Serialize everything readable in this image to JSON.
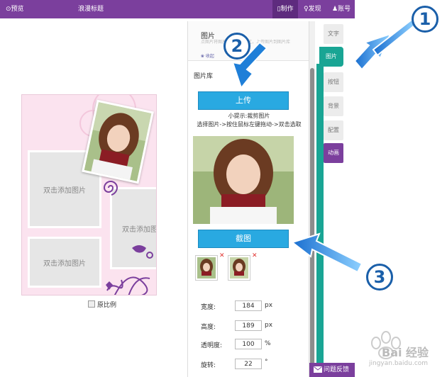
{
  "topbar": {
    "preview": "⊙预览",
    "title": "浪漫标题",
    "make": "▯制作",
    "discover": "♀发现",
    "account": "♟账号"
  },
  "canvas": {
    "slot_label_1": "双击添加图片",
    "slot_label_2": "双击添加图",
    "slot_label_3": "双击添加图片"
  },
  "panel": {
    "head_title": "图片",
    "head_desc": "点图片将图片添加至编辑区，上传图片到图片库",
    "head_link": "❀ 收起",
    "library_label": "图片库",
    "upload_button": "上传",
    "tip_1": "小提示:裁剪图片",
    "tip_2": "选择图片->按住鼠标左键拖动->双击选取",
    "crop_button": "截图",
    "width_label": "宽度:",
    "width_value": "184",
    "width_unit": "px",
    "height_label": "高度:",
    "height_value": "189",
    "height_unit": "px",
    "keep_ratio_label": "原比例",
    "opacity_label": "透明度:",
    "opacity_value": "100",
    "opacity_unit": "%",
    "rotate_label": "旋转:",
    "rotate_value": "22",
    "rotate_unit": "°"
  },
  "side_tabs": {
    "text": "文字",
    "image": "图片",
    "button": "按钮",
    "background": "背景",
    "music": "配置",
    "animation": "动画"
  },
  "feedback": "问题反馈",
  "annotations": {
    "n1": "1",
    "n2": "2",
    "n3": "3"
  },
  "watermark": {
    "brand": "Bai 经验",
    "url": "jingyan.baidu.com"
  },
  "colors": {
    "topbar": "#7b3f9d",
    "teal": "#19a594",
    "button_blue": "#29a9e1",
    "annotation_blue": "#1a5fa9"
  }
}
